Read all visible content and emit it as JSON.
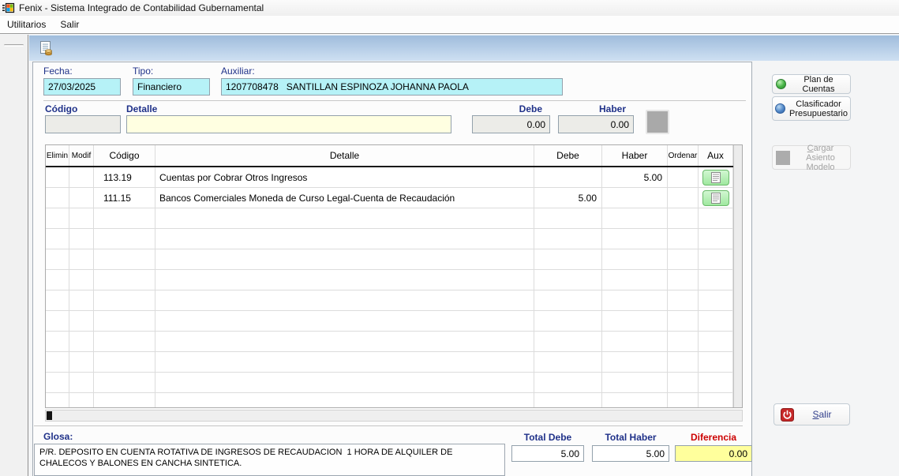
{
  "window": {
    "title": "Fenix - Sistema Integrado de Contabilidad Gubernamental"
  },
  "menu": {
    "utilitarios": "Utilitarios",
    "salir": "Salir"
  },
  "header_form": {
    "fecha_label": "Fecha:",
    "fecha_value": "27/03/2025",
    "tipo_label": "Tipo:",
    "tipo_value": "Financiero",
    "auxiliar_label": "Auxiliar:",
    "auxiliar_value": "1207708478   SANTILLAN ESPINOZA JOHANNA PAOLA"
  },
  "entry_form": {
    "codigo_label": "Código",
    "codigo_value": "",
    "detalle_label": "Detalle",
    "detalle_value": "",
    "debe_label": "Debe",
    "debe_value": "0.00",
    "haber_label": "Haber",
    "haber_value": "0.00"
  },
  "grid": {
    "columns": [
      "Elimin",
      "Modif",
      "Código",
      "Detalle",
      "Debe",
      "Haber",
      "Ordenar",
      "Aux"
    ],
    "rows": [
      {
        "elimin": "",
        "modif": "",
        "codigo": "113.19",
        "detalle": "Cuentas por Cobrar Otros Ingresos",
        "debe": "",
        "haber": "5.00",
        "ordenar": "",
        "aux": "aux-document-button"
      },
      {
        "elimin": "",
        "modif": "",
        "codigo": "111.15",
        "detalle": "Bancos Comerciales Moneda de Curso Legal-Cuenta de Recaudación",
        "debe": "5.00",
        "haber": "",
        "ordenar": "",
        "aux": "aux-document-button"
      }
    ],
    "empty_rows": 10
  },
  "side_buttons": {
    "plan_de_cuentas": "Plan de Cuentas",
    "clasificador": "Clasificador\nPresupuestario",
    "cargar_key": "C",
    "cargar_rest": "argar Asiento",
    "cargar_line2": "Modelo",
    "salir_key": "S",
    "salir_rest": "alir"
  },
  "footer": {
    "glosa_label": "Glosa:",
    "glosa_value": "P/R. DEPOSITO EN CUENTA ROTATIVA DE INGRESOS DE RECAUDACION  1 HORA DE ALQUILER DE CHALECOS Y BALONES EN CANCHA SINTETICA.",
    "total_debe_label": "Total Debe",
    "total_debe_value": "5.00",
    "total_haber_label": "Total Haber",
    "total_haber_value": "5.00",
    "diferencia_label": "Diferencia",
    "diferencia_value": "0.00"
  },
  "colors": {
    "accent_navy": "#1F3189",
    "alert_red": "#CC0000",
    "field_cyan": "#B6F2F7",
    "field_yellow": "#FFFFE1",
    "diferencia_yellow": "#FFFF9C",
    "aux_green": "#9FE89F",
    "toolbar_blue_top": "#9FBCDC",
    "toolbar_blue_bottom": "#CEE0F2"
  }
}
